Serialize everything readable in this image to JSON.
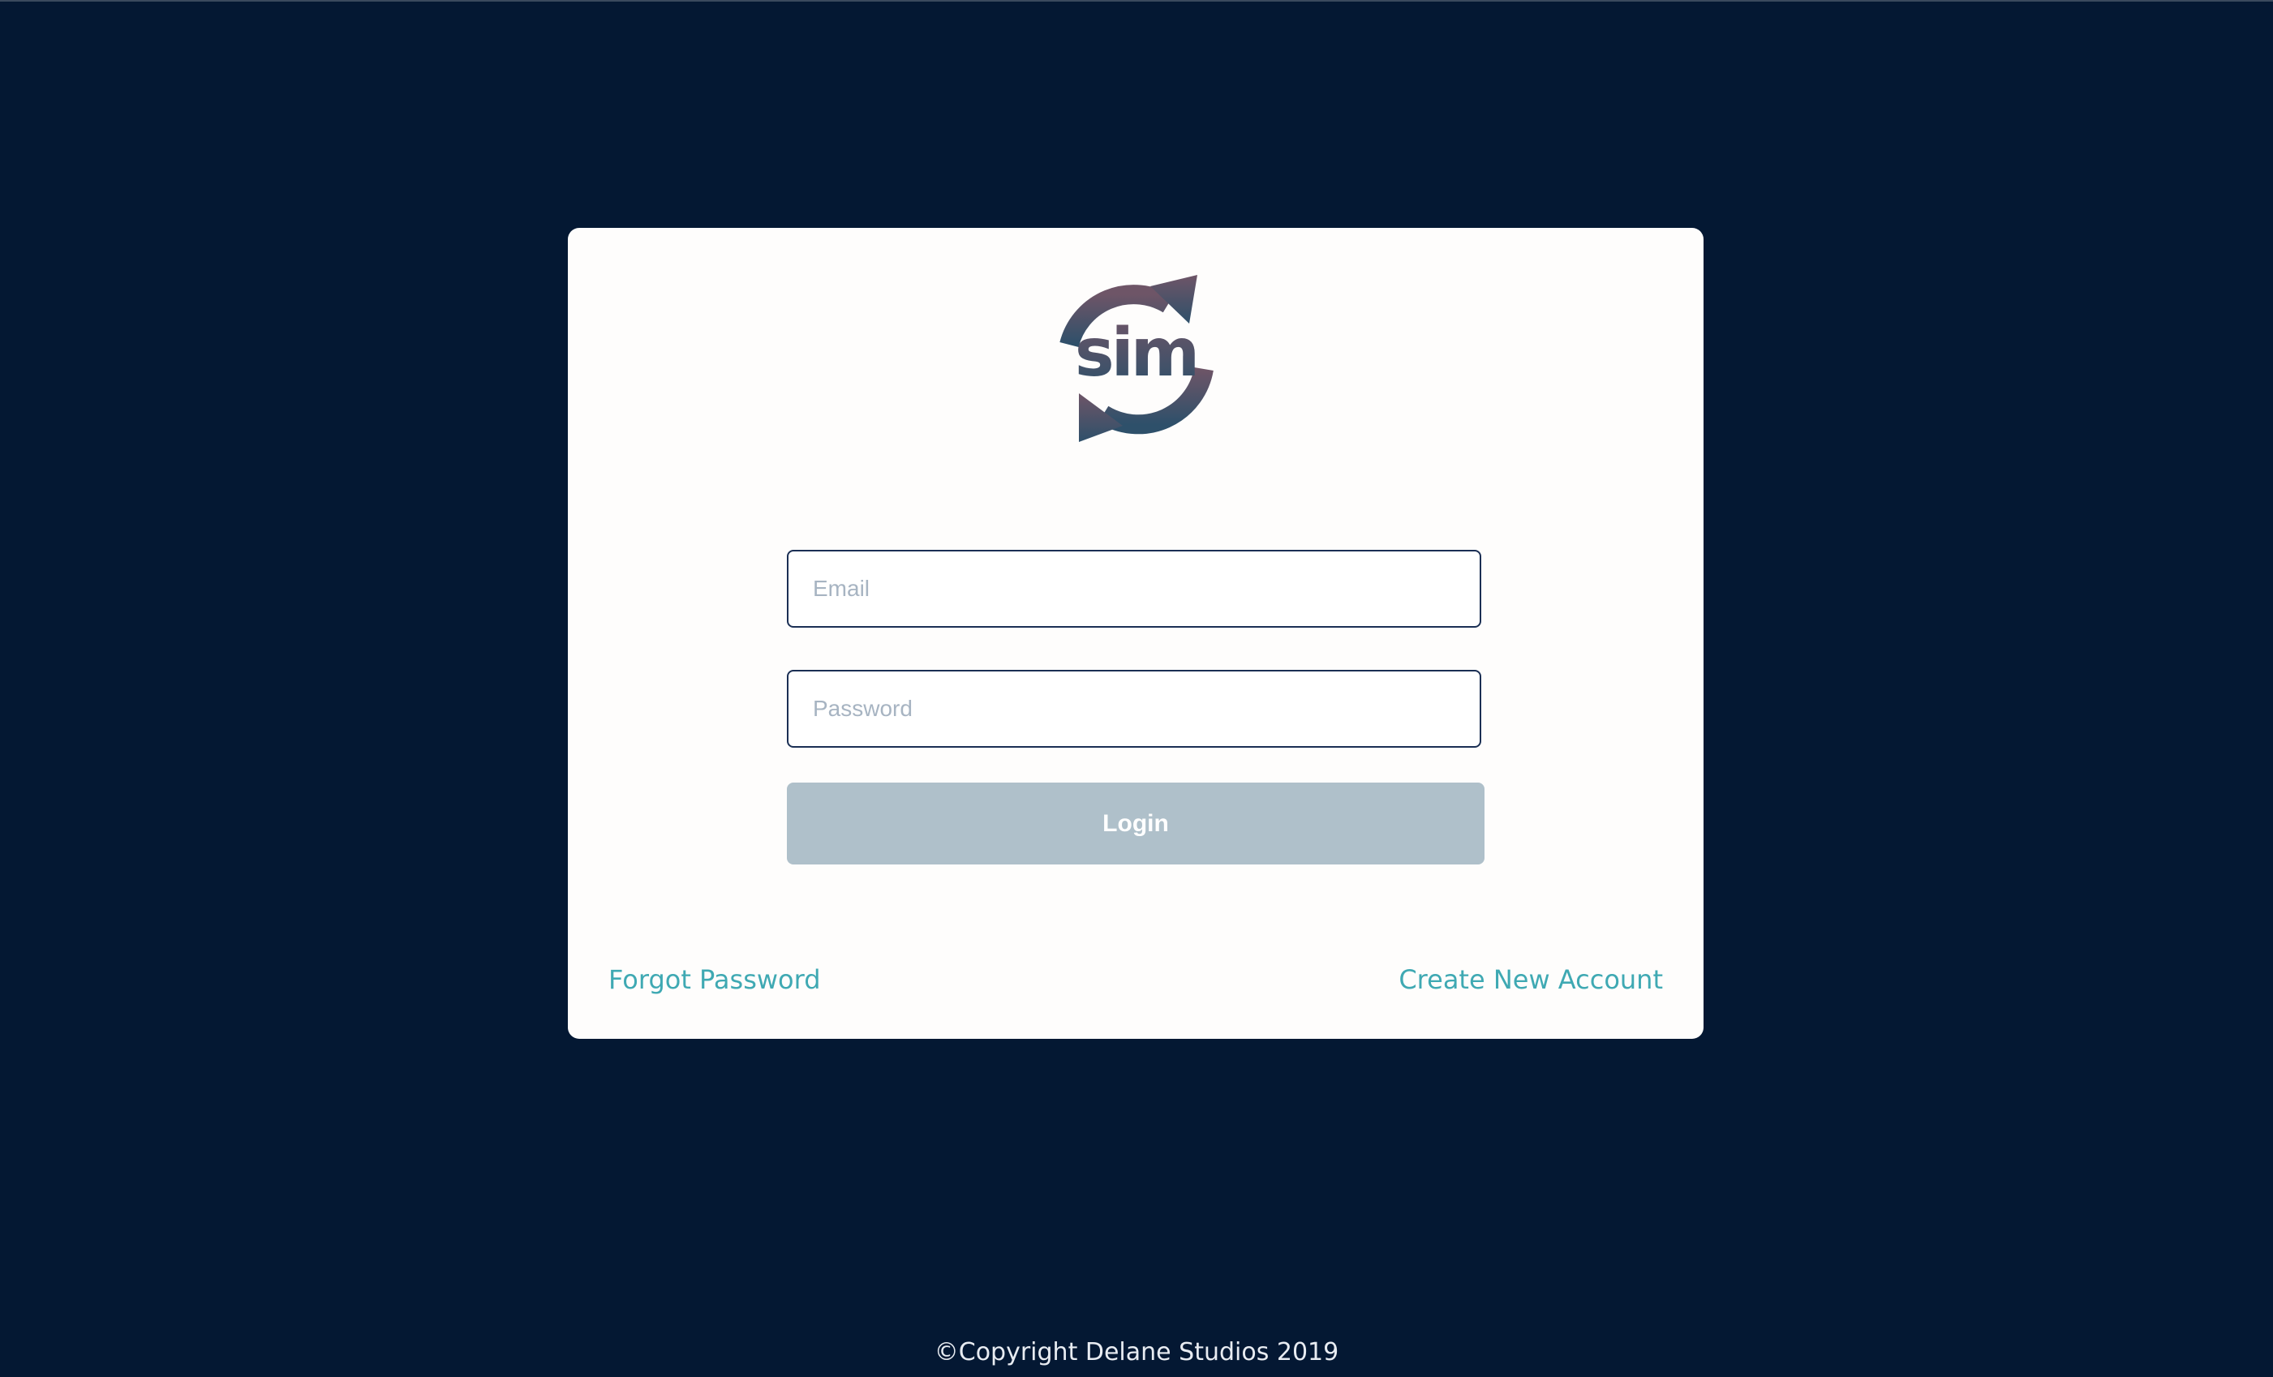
{
  "app": {
    "logo": {
      "text": "sim",
      "icon": "sim-sync-arrows-logo",
      "gradient_top": "#6e5567",
      "gradient_bottom": "#2e506a"
    }
  },
  "login_form": {
    "email": {
      "placeholder": "Email",
      "value": ""
    },
    "password": {
      "placeholder": "Password",
      "value": ""
    },
    "login_label": "Login"
  },
  "links": {
    "forgot_password": "Forgot Password",
    "create_account": "Create New Account"
  },
  "footer": {
    "copyright": "©Copyright Delane Studios 2019"
  },
  "colors": {
    "background": "#041833",
    "card": "#fefdfc",
    "field_border": "#1b2f54",
    "button": "#afc0ca",
    "link": "#3fa9b3"
  }
}
